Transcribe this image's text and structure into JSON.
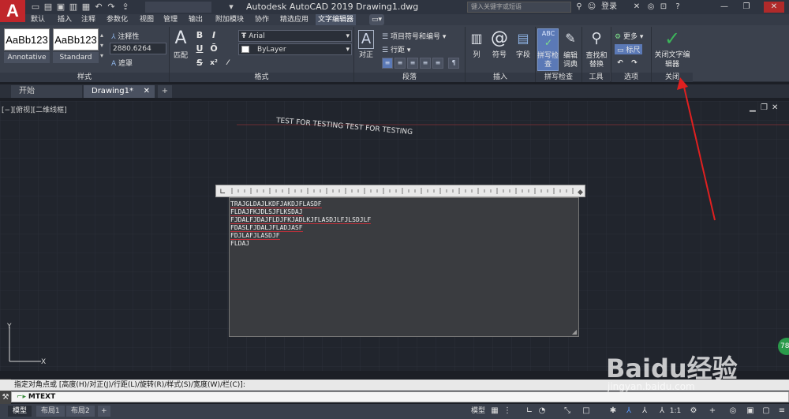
{
  "title_bar": {
    "title": "Autodesk AutoCAD 2019    Drawing1.dwg",
    "search_placeholder": "键入关键字或短语",
    "signin_label": "登录",
    "app_letter": "A"
  },
  "ribbon_tabs": [
    "默认",
    "插入",
    "注释",
    "参数化",
    "视图",
    "管理",
    "输出",
    "附加模块",
    "协作",
    "精选应用",
    "文字编辑器"
  ],
  "active_tab": "文字编辑器",
  "style_panel": {
    "tiles": [
      {
        "sample": "AaBb123",
        "name": "Annotative"
      },
      {
        "sample": "AaBb123",
        "name": "Standard"
      }
    ],
    "annotative_label": "注释性",
    "height_value": "2880.6264",
    "mask_label": "遮罩",
    "match_label": "匹配",
    "panel_title": "样式"
  },
  "format_panel": {
    "bold": "B",
    "italic": "I",
    "underline": "U",
    "overline": "Ō",
    "strike": "S",
    "font": "Arial",
    "color": "ByLayer",
    "panel_title": "格式"
  },
  "paragraph_panel": {
    "justify_label": "对正",
    "bullets_label": "项目符号和编号",
    "line_spacing_label": "行距",
    "panel_title": "段落"
  },
  "insert_panel": {
    "columns_label": "列",
    "symbol_label": "符号",
    "field_label": "字段",
    "panel_title": "插入"
  },
  "spellcheck_panel": {
    "spell_label": "拼写检查",
    "dict_label": "编辑词典",
    "panel_title": "拼写检查"
  },
  "tools_panel": {
    "find_label": "查找和替换",
    "panel_title": "工具"
  },
  "options_panel": {
    "more_label": "更多",
    "ruler_label": "标尺",
    "panel_title": "选项"
  },
  "close_panel": {
    "close_label": "关闭文字编辑器",
    "panel_title": "关闭"
  },
  "doc_tabs": [
    "开始",
    "Drawing1*"
  ],
  "viewport_label": "[−][俯视][二维线框]",
  "curved_text": "TEST FOR TESTING TEST FOR TESTING",
  "editor_lines": [
    "TRAJGLDAJLKDFJAKDJFLASDF",
    "FLDAJFKJDLSJFLKSDAJ",
    "FJDALFJDAJFLDJFKJADLKJFLASDJLFJLSDJLF",
    "FDASLFJDALJFLADJASF",
    "FDJLAFJLASDJF",
    "FLDAJ"
  ],
  "command": {
    "history": "指定对角点或 [高度(H)/对正(J)/行距(L)/旋转(R)/样式(S)/宽度(W)/栏(C)]:",
    "current": "MTEXT"
  },
  "layout_tabs": [
    "模型",
    "布局1",
    "布局2"
  ],
  "status": {
    "model": "模型",
    "scale": "1:1"
  },
  "watermark": {
    "brand": "Baidu经验",
    "url": "jingyan.baidu.com"
  },
  "badge_text": "78",
  "colors": {
    "accent": "#c0262b",
    "arrow": "#e02020",
    "close_check": "#3cb55a"
  }
}
